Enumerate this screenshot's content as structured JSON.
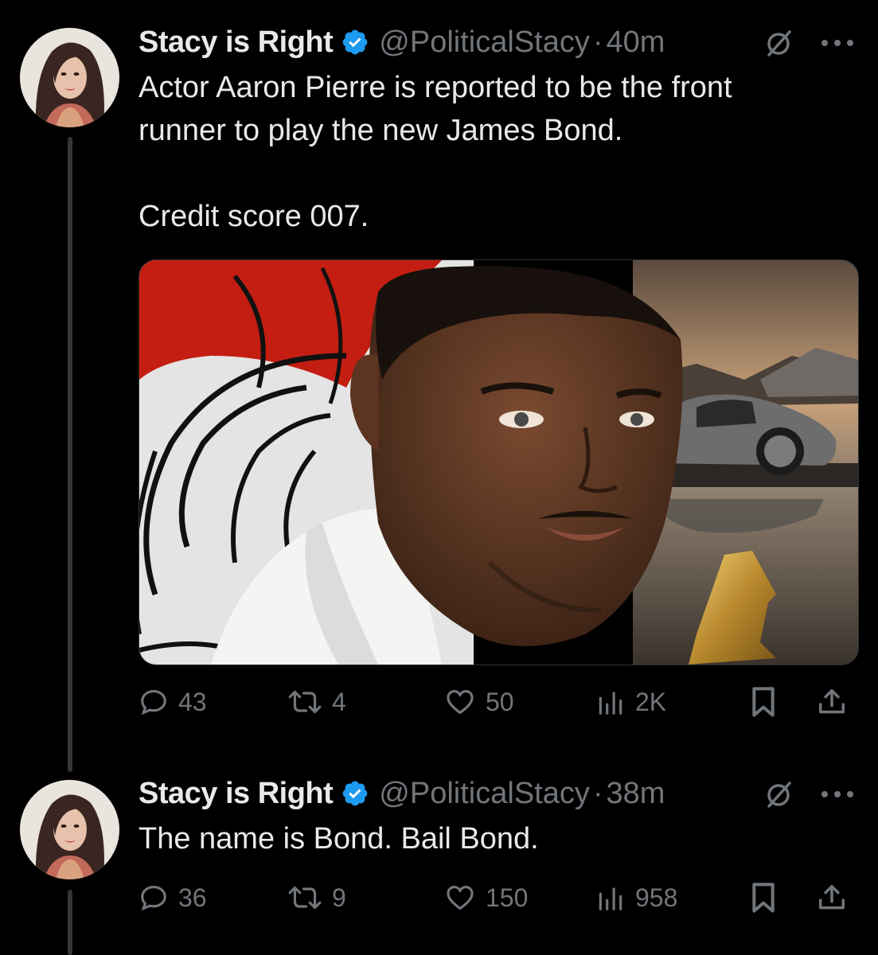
{
  "tweets": [
    {
      "author_name": "Stacy is Right",
      "handle": "@PoliticalStacy",
      "separator": "·",
      "time": "40m",
      "text": "Actor Aaron Pierre is reported to be the front\nrunner to play the new James Bond.\n\nCredit score 007.",
      "stats": {
        "replies": "43",
        "reposts": "4",
        "likes": "50",
        "views": "2K"
      }
    },
    {
      "author_name": "Stacy is Right",
      "handle": "@PoliticalStacy",
      "separator": "·",
      "time": "38m",
      "text": "The name is Bond. Bail Bond.",
      "stats": {
        "replies": "36",
        "reposts": "9",
        "likes": "150",
        "views": "958"
      }
    }
  ],
  "colors": {
    "background": "#000000",
    "text": "#e7e9ea",
    "muted": "#71767b",
    "verified": "#1d9bf0",
    "thread_line": "#333639"
  },
  "icons": [
    "verified-badge-icon",
    "grok-icon",
    "more-icon",
    "reply-icon",
    "repost-icon",
    "like-icon",
    "views-icon",
    "bookmark-icon",
    "share-icon"
  ]
}
